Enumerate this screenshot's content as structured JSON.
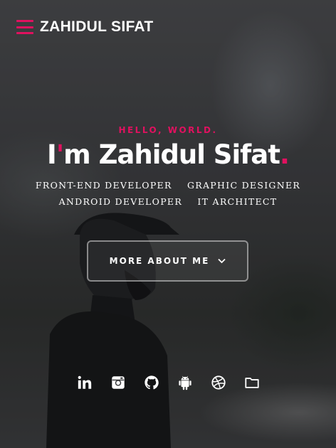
{
  "header": {
    "brand": "ZAHIDUL SIFAT"
  },
  "intro": {
    "greeting": "HELLO, WORLD.",
    "headline_prefix": "I",
    "headline_apostrophe": "'",
    "headline_rest": "m Zahidul Sifat",
    "headline_dot": ".",
    "roles_row1": [
      "FRONT-END DEVELOPER",
      "GRAPHIC DESIGNER"
    ],
    "roles_row2": [
      "ANDROID DEVELOPER",
      "IT ARCHITECT"
    ]
  },
  "cta": {
    "label": "MORE ABOUT ME"
  },
  "social": [
    {
      "icon": "linkedin-icon"
    },
    {
      "icon": "instagram-icon"
    },
    {
      "icon": "github-icon"
    },
    {
      "icon": "android-icon"
    },
    {
      "icon": "dribbble-icon"
    },
    {
      "icon": "folder-icon"
    }
  ],
  "colors": {
    "accent": "#e0115f",
    "text": "#ffffff"
  }
}
